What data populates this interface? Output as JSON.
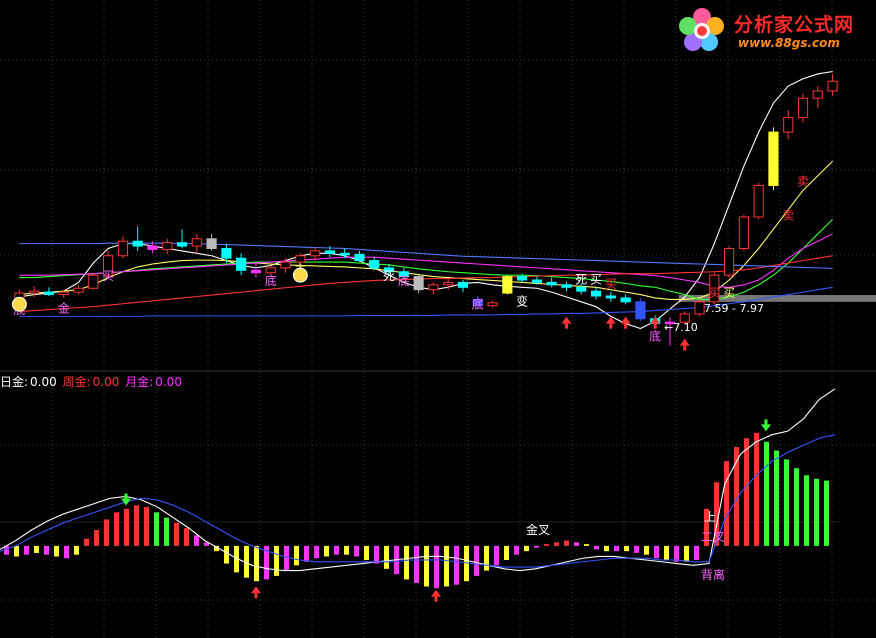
{
  "logo": {
    "title": "分析家公式网",
    "url": "www.88gs.com"
  },
  "colors": {
    "background": "#000000",
    "up": "#ff3333",
    "down": "#00ffff",
    "pink": "#ff33ff",
    "yellow": "#ffff33",
    "green": "#33ff33",
    "white": "#ffffff",
    "blue": "#3355ff"
  },
  "upper_annotations": {
    "range_label": "7.59 - 7.97",
    "low_label": "←7.10",
    "signals": [
      "底",
      "金",
      "买",
      "底",
      "主",
      "买",
      "死",
      "底",
      "底",
      "变",
      "死",
      "买",
      "底",
      "买",
      "买",
      "卖",
      "卖"
    ]
  },
  "legend": {
    "day": {
      "label": "日金:",
      "value": "0.00"
    },
    "week": {
      "label": "周金:",
      "value": "0.00"
    },
    "month": {
      "label": "月金:",
      "value": "0.00"
    }
  },
  "lower_annotations": {
    "golden_cross": "金叉",
    "up_label": "上",
    "second_cross": "二叉",
    "divergence": "背离"
  },
  "chart_data": [
    {
      "type": "candlestick",
      "title": "",
      "candles": [
        [
          1,
          8.05,
          8.25,
          7.98,
          8.18
        ],
        [
          2,
          8.18,
          8.32,
          8.1,
          8.22
        ],
        [
          3,
          8.2,
          8.3,
          8.12,
          8.15
        ],
        [
          4,
          8.15,
          8.24,
          8.08,
          8.2
        ],
        [
          5,
          8.2,
          8.35,
          8.15,
          8.28
        ],
        [
          6,
          8.28,
          8.6,
          8.25,
          8.55
        ],
        [
          7,
          8.55,
          9.05,
          8.5,
          8.95
        ],
        [
          8,
          8.95,
          9.35,
          8.9,
          9.25
        ],
        [
          9,
          9.25,
          9.55,
          9.05,
          9.15
        ],
        [
          10,
          9.15,
          9.25,
          9.0,
          9.08
        ],
        [
          11,
          9.08,
          9.3,
          8.98,
          9.22
        ],
        [
          12,
          9.22,
          9.5,
          9.1,
          9.15
        ],
        [
          13,
          9.15,
          9.4,
          9.0,
          9.3
        ],
        [
          14,
          9.3,
          9.4,
          9.05,
          9.1
        ],
        [
          15,
          9.1,
          9.2,
          8.8,
          8.9
        ],
        [
          16,
          8.9,
          9.0,
          8.55,
          8.65
        ],
        [
          17,
          8.65,
          8.8,
          8.5,
          8.6
        ],
        [
          18,
          8.6,
          8.75,
          8.55,
          8.7
        ],
        [
          19,
          8.7,
          8.9,
          8.6,
          8.82
        ],
        [
          20,
          8.82,
          9.0,
          8.7,
          8.95
        ],
        [
          21,
          8.95,
          9.12,
          8.85,
          9.05
        ],
        [
          22,
          9.05,
          9.15,
          8.92,
          9.0
        ],
        [
          23,
          9.0,
          9.1,
          8.9,
          8.98
        ],
        [
          24,
          8.98,
          9.05,
          8.82,
          8.85
        ],
        [
          25,
          8.85,
          8.92,
          8.65,
          8.7
        ],
        [
          26,
          8.7,
          8.78,
          8.55,
          8.62
        ],
        [
          27,
          8.62,
          8.7,
          8.48,
          8.52
        ],
        [
          28,
          8.52,
          8.58,
          8.18,
          8.25
        ],
        [
          29,
          8.25,
          8.4,
          8.15,
          8.35
        ],
        [
          30,
          8.35,
          8.48,
          8.25,
          8.4
        ],
        [
          31,
          8.4,
          8.45,
          8.2,
          8.3
        ],
        [
          32,
          8.05,
          8.12,
          7.85,
          7.92
        ],
        [
          33,
          7.92,
          8.02,
          7.88,
          7.98
        ],
        [
          34,
          8.18,
          8.55,
          8.15,
          8.52
        ],
        [
          35,
          8.52,
          8.58,
          8.4,
          8.45
        ],
        [
          36,
          8.45,
          8.52,
          8.35,
          8.4
        ],
        [
          37,
          8.4,
          8.5,
          8.3,
          8.35
        ],
        [
          38,
          8.35,
          8.42,
          8.22,
          8.3
        ],
        [
          39,
          8.3,
          8.38,
          8.15,
          8.22
        ],
        [
          40,
          8.22,
          8.3,
          8.05,
          8.12
        ],
        [
          41,
          8.12,
          8.2,
          8.0,
          8.08
        ],
        [
          42,
          8.08,
          8.15,
          7.95,
          8.0
        ],
        [
          43,
          8.0,
          8.08,
          7.6,
          7.65
        ],
        [
          44,
          7.65,
          7.72,
          7.48,
          7.55
        ],
        [
          45,
          7.55,
          7.68,
          7.1,
          7.58
        ],
        [
          46,
          7.58,
          7.8,
          7.52,
          7.75
        ],
        [
          47,
          7.75,
          8.05,
          7.7,
          8.0
        ],
        [
          48,
          8.0,
          8.6,
          7.95,
          8.55
        ],
        [
          49,
          8.55,
          9.15,
          8.5,
          9.1
        ],
        [
          50,
          9.1,
          9.8,
          9.05,
          9.75
        ],
        [
          51,
          9.75,
          10.45,
          9.7,
          10.4
        ],
        [
          52,
          10.4,
          11.6,
          10.3,
          11.5
        ],
        [
          53,
          11.5,
          11.95,
          11.35,
          11.8
        ],
        [
          54,
          11.8,
          12.3,
          11.7,
          12.2
        ],
        [
          55,
          12.2,
          12.45,
          12.0,
          12.35
        ],
        [
          56,
          12.35,
          12.7,
          12.25,
          12.55
        ]
      ],
      "series": [
        {
          "name": "",
          "values": [
            8.1,
            8.15,
            8.18,
            8.22,
            8.4,
            8.8,
            9.1,
            9.2,
            9.2,
            9.15,
            9.1,
            9.05,
            9.0,
            8.95,
            8.85,
            8.75,
            8.7,
            8.75,
            8.85,
            8.95,
            9.0,
            9.0,
            8.95,
            8.85,
            8.7,
            8.55,
            8.4,
            8.3,
            8.25,
            8.3,
            8.38,
            8.4,
            8.35,
            8.32,
            8.3,
            8.28,
            8.2,
            8.1,
            8.0,
            7.9,
            7.7,
            7.55,
            7.45,
            7.6,
            7.85,
            8.1,
            8.5,
            9.2,
            10.0,
            10.8,
            11.5,
            12.1,
            12.45,
            12.6,
            12.7,
            12.75
          ]
        },
        {
          "name": "",
          "values": [
            8.15,
            8.18,
            8.2,
            8.22,
            8.25,
            8.35,
            8.5,
            8.62,
            8.72,
            8.78,
            8.82,
            8.85,
            8.86,
            8.86,
            8.85,
            8.82,
            8.8,
            8.78,
            8.76,
            8.75,
            8.74,
            8.73,
            8.72,
            8.7,
            8.68,
            8.64,
            8.6,
            8.56,
            8.52,
            8.5,
            8.48,
            8.46,
            8.44,
            8.42,
            8.4,
            8.38,
            8.36,
            8.34,
            8.32,
            8.3,
            8.25,
            8.2,
            8.15,
            8.08,
            8.05,
            8.05,
            8.08,
            8.2,
            8.45,
            8.75,
            9.1,
            9.5,
            9.9,
            10.3,
            10.6,
            10.9
          ]
        },
        {
          "name": "",
          "values": [
            8.5,
            8.5,
            8.52,
            8.54,
            8.56,
            8.58,
            8.6,
            8.62,
            8.65,
            8.68,
            8.7,
            8.72,
            8.74,
            8.76,
            8.78,
            8.8,
            8.82,
            8.82,
            8.82,
            8.82,
            8.82,
            8.82,
            8.82,
            8.8,
            8.78,
            8.76,
            8.72,
            8.68,
            8.65,
            8.62,
            8.6,
            8.58,
            8.56,
            8.55,
            8.55,
            8.54,
            8.52,
            8.5,
            8.48,
            8.45,
            8.42,
            8.38,
            8.33,
            8.3,
            8.22,
            8.15,
            8.05,
            8.05,
            8.1,
            8.2,
            8.35,
            8.55,
            8.8,
            9.1,
            9.4,
            9.7
          ]
        },
        {
          "name": "",
          "values": [
            8.55,
            8.55,
            8.55,
            8.56,
            8.57,
            8.58,
            8.6,
            8.62,
            8.64,
            8.66,
            8.68,
            8.7,
            8.72,
            8.74,
            8.76,
            8.78,
            8.8,
            8.82,
            8.84,
            8.86,
            8.88,
            8.9,
            8.92,
            8.92,
            8.92,
            8.9,
            8.88,
            8.86,
            8.84,
            8.82,
            8.8,
            8.78,
            8.76,
            8.74,
            8.72,
            8.7,
            8.68,
            8.66,
            8.64,
            8.62,
            8.6,
            8.58,
            8.56,
            8.54,
            8.5,
            8.45,
            8.4,
            8.32,
            8.3,
            8.35,
            8.45,
            8.65,
            8.9,
            9.1,
            9.25,
            9.4
          ]
        },
        {
          "name": "",
          "values": [
            7.8,
            7.82,
            7.84,
            7.86,
            7.88,
            7.9,
            7.93,
            7.96,
            7.99,
            8.02,
            8.05,
            8.08,
            8.11,
            8.14,
            8.17,
            8.2,
            8.23,
            8.26,
            8.29,
            8.32,
            8.35,
            8.38,
            8.4,
            8.42,
            8.44,
            8.45,
            8.46,
            8.47,
            8.48,
            8.48,
            8.49,
            8.5,
            8.5,
            8.51,
            8.52,
            8.53,
            8.54,
            8.55,
            8.55,
            8.56,
            8.57,
            8.58,
            8.58,
            8.58,
            8.59,
            8.6,
            8.61,
            8.62,
            8.64,
            8.66,
            8.7,
            8.75,
            8.8,
            8.85,
            8.9,
            8.95
          ]
        },
        {
          "name": "",
          "values": [
            9.2,
            9.2,
            9.2,
            9.2,
            9.2,
            9.2,
            9.21,
            9.21,
            9.21,
            9.21,
            9.21,
            9.2,
            9.2,
            9.19,
            9.18,
            9.17,
            9.16,
            9.15,
            9.14,
            9.13,
            9.12,
            9.11,
            9.1,
            9.08,
            9.06,
            9.04,
            9.02,
            9.0,
            8.98,
            8.96,
            8.94,
            8.93,
            8.92,
            8.91,
            8.9,
            8.89,
            8.88,
            8.87,
            8.86,
            8.85,
            8.84,
            8.83,
            8.82,
            8.81,
            8.8,
            8.79,
            8.78,
            8.77,
            8.76,
            8.75,
            8.74,
            8.73,
            8.72,
            8.71,
            8.7,
            8.69
          ]
        },
        {
          "name": "",
          "values": [
            7.7,
            7.7,
            7.7,
            7.7,
            7.7,
            7.7,
            7.7,
            7.7,
            7.7,
            7.71,
            7.71,
            7.71,
            7.71,
            7.71,
            7.71,
            7.71,
            7.71,
            7.71,
            7.71,
            7.71,
            7.71,
            7.71,
            7.71,
            7.72,
            7.72,
            7.72,
            7.72,
            7.72,
            7.72,
            7.73,
            7.73,
            7.73,
            7.73,
            7.74,
            7.74,
            7.75,
            7.75,
            7.76,
            7.76,
            7.77,
            7.78,
            7.79,
            7.8,
            7.82,
            7.84,
            7.86,
            7.88,
            7.92,
            7.96,
            8.0,
            8.05,
            8.1,
            8.15,
            8.2,
            8.25,
            8.3
          ]
        }
      ],
      "band": [
        8.0,
        8.14
      ],
      "ylim": [
        6.8,
        13.4
      ]
    },
    {
      "type": "bar",
      "title": "",
      "x": [
        1,
        2,
        3,
        4,
        5,
        6,
        7,
        8,
        9,
        10,
        11,
        12,
        13,
        14,
        15,
        16,
        17,
        18,
        19,
        20,
        21,
        22,
        23,
        24,
        25,
        26,
        27,
        28,
        29,
        30,
        31,
        32,
        33,
        34,
        35,
        36,
        37,
        38,
        39,
        40,
        41,
        42,
        43,
        44,
        45,
        46,
        47,
        48,
        49,
        50,
        51,
        52,
        53,
        54,
        55,
        56,
        57,
        58,
        59,
        60,
        61,
        62,
        63,
        64,
        65,
        66,
        67,
        68,
        69,
        70,
        71,
        72,
        73,
        74,
        75,
        76,
        77,
        78,
        79,
        80,
        81,
        82,
        83,
        84,
        85,
        86,
        87,
        88,
        89,
        90,
        91,
        92,
        93,
        94,
        95,
        96,
        97,
        98,
        99,
        100,
        101,
        102,
        103,
        104,
        105,
        106,
        107,
        108,
        109,
        110,
        111,
        112,
        113,
        114,
        115,
        116,
        117,
        118,
        119,
        120
      ],
      "values": [
        -0.5,
        -0.6,
        -0.5,
        -0.4,
        -0.5,
        -0.6,
        -0.7,
        -0.5,
        0.4,
        0.9,
        1.5,
        1.9,
        2.1,
        2.3,
        2.2,
        1.9,
        1.6,
        1.3,
        1.0,
        0.6,
        0.2,
        -0.3,
        -1.0,
        -1.5,
        -1.8,
        -2.0,
        -1.9,
        -1.7,
        -1.4,
        -1.1,
        -0.9,
        -0.7,
        -0.6,
        -0.5,
        -0.5,
        -0.6,
        -0.8,
        -1.0,
        -1.3,
        -1.6,
        -1.9,
        -2.1,
        -2.3,
        -2.4,
        -2.3,
        -2.2,
        -2.0,
        -1.7,
        -1.4,
        -1.1,
        -0.8,
        -0.5,
        -0.3,
        -0.1,
        0.1,
        0.2,
        0.3,
        0.2,
        0.1,
        -0.2,
        -0.3,
        -0.3,
        -0.3,
        -0.4,
        -0.5,
        -0.7,
        -0.8,
        -0.9,
        -0.9,
        -0.8,
        2.1,
        3.6,
        4.8,
        5.6,
        6.1,
        6.4,
        5.9,
        5.4,
        4.9,
        4.4,
        4.0,
        3.8,
        3.7
      ],
      "colors": [
        "p",
        "y",
        "p",
        "y",
        "p",
        "y",
        "p",
        "y",
        "r",
        "r",
        "r",
        "r",
        "r",
        "r",
        "r",
        "g",
        "g",
        "r",
        "r",
        "p",
        "p",
        "y",
        "y",
        "y",
        "y",
        "y",
        "p",
        "y",
        "p",
        "y",
        "p",
        "p",
        "y",
        "p",
        "y",
        "p",
        "y",
        "p",
        "y",
        "p",
        "y",
        "p",
        "y",
        "p",
        "y",
        "p",
        "y",
        "p",
        "y",
        "p",
        "y",
        "p",
        "y",
        "p",
        "r",
        "r",
        "r",
        "p",
        "y",
        "p",
        "y",
        "p",
        "y",
        "p",
        "y",
        "p",
        "y",
        "p",
        "y",
        "p",
        "r",
        "r",
        "r",
        "r",
        "r",
        "r",
        "g",
        "g",
        "g",
        "g",
        "g",
        "g",
        "g"
      ],
      "lines": [
        {
          "name": "",
          "values": [
            -0.2,
            0.3,
            0.9,
            1.4,
            1.8,
            2.1,
            2.4,
            2.7,
            2.8,
            2.6,
            2.2,
            1.6,
            1.0,
            0.3,
            -0.2,
            -0.7,
            -1.1,
            -1.3,
            -1.4,
            -1.4,
            -1.3,
            -1.2,
            -1.1,
            -1.0,
            -0.9,
            -0.8,
            -0.7,
            -0.6,
            -0.6,
            -0.7,
            -0.9,
            -1.1,
            -1.3,
            -1.4,
            -1.3,
            -1.1,
            -0.9,
            -0.7,
            -0.6,
            -0.6,
            -0.7,
            -0.8,
            -0.9,
            -1.0,
            -1.1,
            -1.0,
            3.5,
            5.2,
            5.9,
            6.3,
            6.5,
            7.2,
            8.3,
            8.9
          ]
        },
        {
          "name": "",
          "values": [
            -0.3,
            0.0,
            0.5,
            0.9,
            1.3,
            1.6,
            1.9,
            2.2,
            2.5,
            2.7,
            2.6,
            2.3,
            1.9,
            1.4,
            0.9,
            0.4,
            0.0,
            -0.3,
            -0.6,
            -0.8,
            -0.9,
            -0.9,
            -0.9,
            -0.9,
            -0.9,
            -0.9,
            -0.8,
            -0.8,
            -0.8,
            -0.9,
            -1.0,
            -1.1,
            -1.2,
            -1.2,
            -1.2,
            -1.1,
            -1.0,
            -0.9,
            -0.8,
            -0.7,
            -0.7,
            -0.7,
            -0.8,
            -0.8,
            -0.9,
            -0.9,
            1.5,
            3.0,
            4.0,
            4.8,
            5.3,
            5.7,
            6.1,
            6.3
          ]
        }
      ],
      "ylim": [
        -4.2,
        9.4
      ]
    }
  ]
}
